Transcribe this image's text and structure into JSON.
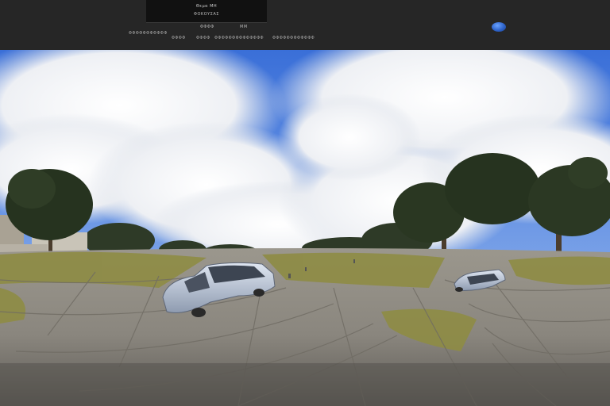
{
  "header": {
    "title_line1": "Θεμα ΜΗ",
    "title_line2": "ΦΟΚΟΥΣΑΣ",
    "sub_label_left": "ΦΦΦΦ",
    "sub_label_right": "ΜΜ",
    "site_label": "ΦΦΦΦΦΦΦΦΦΦΦ",
    "nav_items": [
      "ΦΦΦΦ",
      "ΦΦΦΦ",
      "ΦΦΦΦΦΦΦΦΦΦΦΦΦΦ",
      "ΦΦΦΦΦΦΦΦΦΦΦΦ"
    ]
  },
  "icons": {
    "globe": "globe-icon"
  },
  "panorama": {
    "scene": "360-panorama-viewer"
  },
  "colors": {
    "topbar": "#262626",
    "sky": "#2f63d6",
    "ground": "#8f8a82",
    "grass": "#8a8a3e",
    "car": "#b9c4d6"
  }
}
